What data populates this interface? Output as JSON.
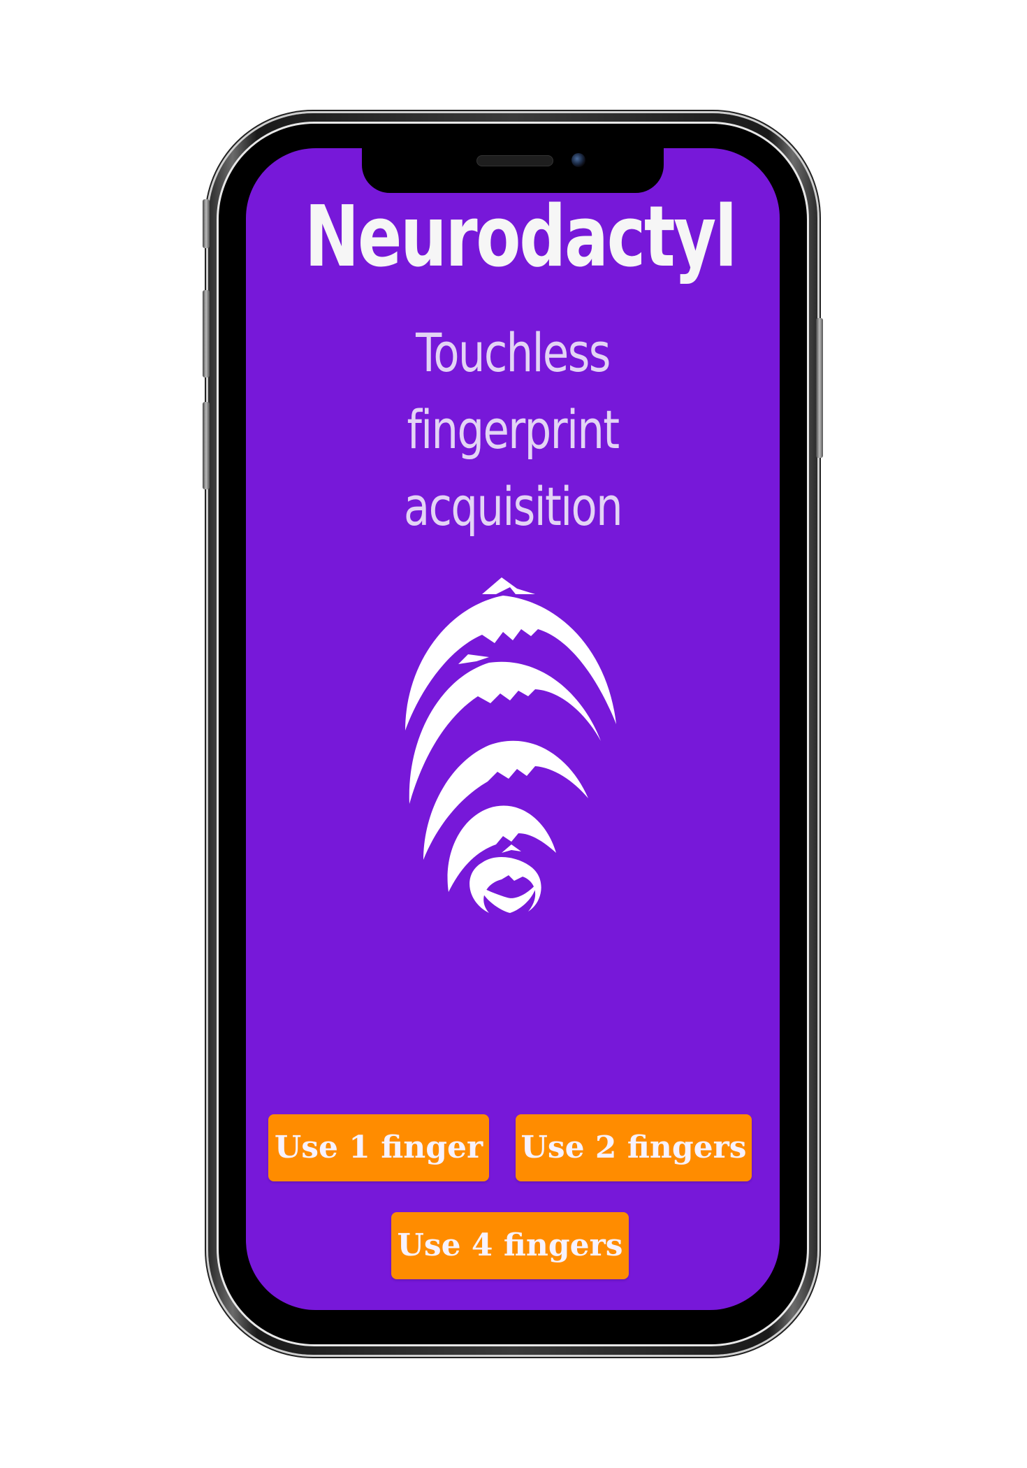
{
  "app": {
    "title": "Neurodactyl",
    "subtitle": "Touchless fingerprint acquisition",
    "logo_icon": "fingerprint-logo-icon"
  },
  "buttons": {
    "one_finger": "Use 1 finger",
    "two_fingers": "Use 2 fingers",
    "four_fingers": "Use 4 fingers"
  },
  "colors": {
    "background": "#7718d9",
    "button": "#ff8c00",
    "text": "#ffffff"
  }
}
